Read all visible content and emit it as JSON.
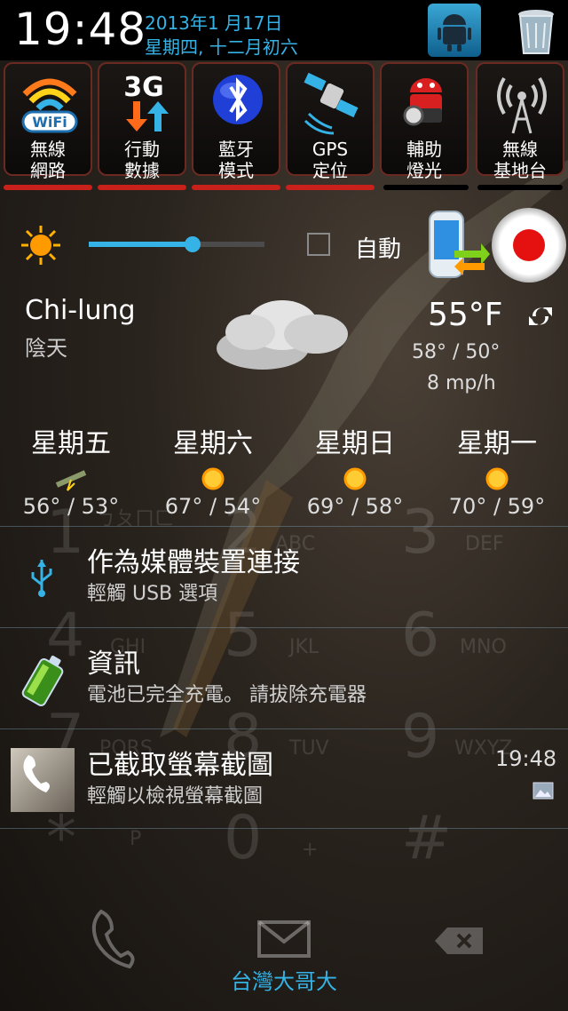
{
  "status": {
    "time": "19:48",
    "date_line1": "2013年1 月17日",
    "date_line2": "星期四, 十二月初六"
  },
  "toggles": [
    {
      "label1": "無線",
      "label2": "網路",
      "icon": "wifi-icon",
      "state_color": "#c8201a"
    },
    {
      "label1": "行動",
      "label2": "數據",
      "icon": "mobile-data-3g-icon",
      "state_color": "#c8201a"
    },
    {
      "label1": "藍牙",
      "label2": "模式",
      "icon": "bluetooth-icon",
      "state_color": "#c8201a"
    },
    {
      "label1": "GPS",
      "label2": "定位",
      "icon": "gps-satellite-icon",
      "state_color": "#c8201a"
    },
    {
      "label1": "輔助",
      "label2": "燈光",
      "icon": "flashlight-android-icon",
      "state_color": "#000000"
    },
    {
      "label1": "無線",
      "label2": "基地台",
      "icon": "hotspot-icon",
      "state_color": "#000000"
    }
  ],
  "brightness": {
    "level": 0.59,
    "auto_label": "自動",
    "auto_checked": false
  },
  "weather": {
    "city": "Chi-lung",
    "condition": "陰天",
    "temp": "55°F",
    "hi_lo": "58° / 50°",
    "wind": "8 mp/h",
    "forecast": [
      {
        "day": "星期五",
        "temps": "56° / 53°",
        "icon": "storm-icon"
      },
      {
        "day": "星期六",
        "temps": "67° / 54°",
        "icon": "sun-icon"
      },
      {
        "day": "星期日",
        "temps": "69° / 58°",
        "icon": "sun-icon"
      },
      {
        "day": "星期一",
        "temps": "70° / 59°",
        "icon": "sun-icon"
      }
    ]
  },
  "notifications": [
    {
      "title": "作為媒體裝置連接",
      "subtitle": "輕觸 USB 選項",
      "icon": "usb-icon"
    },
    {
      "title": "資訊",
      "subtitle": "電池已完全充電。 請拔除充電器",
      "icon": "battery-full-icon"
    },
    {
      "title": "已截取螢幕截圖",
      "subtitle": "輕觸以檢視螢幕截圖",
      "time": "19:48",
      "icon": "screenshot-thumbnail"
    }
  ],
  "dialer_bg": {
    "keys": [
      {
        "num": "1",
        "sub": "ㄅㄆㄇㄈ"
      },
      {
        "num": "2",
        "sub": "ABC"
      },
      {
        "num": "3",
        "sub": "DEF"
      },
      {
        "num": "4",
        "sub": "GHI"
      },
      {
        "num": "5",
        "sub": "JKL"
      },
      {
        "num": "6",
        "sub": "MNO"
      },
      {
        "num": "7",
        "sub": "PQRS"
      },
      {
        "num": "8",
        "sub": "TUV"
      },
      {
        "num": "9",
        "sub": "WXYZ"
      },
      {
        "num": "*",
        "sub": "P"
      },
      {
        "num": "0",
        "sub": "+"
      },
      {
        "num": "#",
        "sub": ""
      }
    ]
  },
  "carrier": "台灣大哥大"
}
